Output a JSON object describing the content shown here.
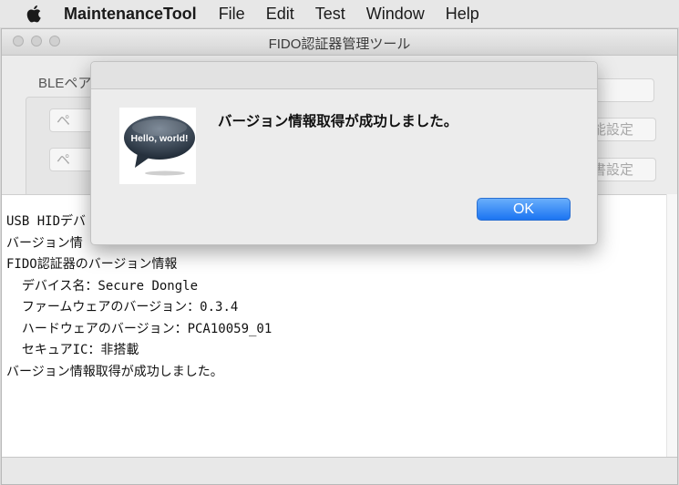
{
  "menubar": {
    "apple_icon": "apple-logo-icon",
    "app_name": "MaintenanceTool",
    "items": [
      "File",
      "Edit",
      "Test",
      "Window",
      "Help"
    ]
  },
  "window": {
    "title": "FIDO認証器管理ツール"
  },
  "panel": {
    "group_label": "BLEペア",
    "left_buttons": [
      "ペ",
      "ペ"
    ],
    "right_buttons": [
      "能設定",
      "書設定"
    ]
  },
  "log": {
    "lines": [
      "USB HIDデバ",
      "バージョン情",
      "FIDO認証器のバージョン情報",
      "  デバイス名：Secure Dongle",
      "  ファームウェアのバージョン：0.3.4",
      "  ハードウェアのバージョン：PCA10059_01",
      "  セキュアIC：非搭載",
      "バージョン情報取得が成功しました。"
    ]
  },
  "alert": {
    "icon_text": "Hello, world!",
    "message": "バージョン情報取得が成功しました。",
    "ok_label": "OK"
  },
  "colors": {
    "accent": "#1b74f2",
    "window_bg": "#ececec"
  }
}
